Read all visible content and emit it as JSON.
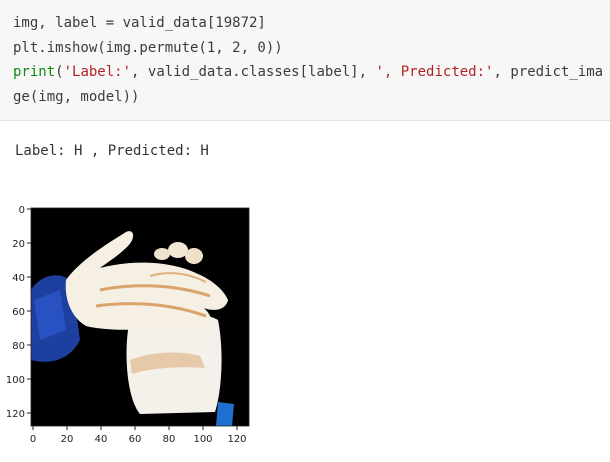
{
  "code": {
    "line1": "img, label = valid_data[19872]",
    "line2": "plt.imshow(img.permute(1, 2, 0))",
    "line3_print": "print",
    "line3_open": "(",
    "line3_str1": "'Label:'",
    "line3_mid": ", valid_data.classes[label], ",
    "line3_str2": "', Predicted:'",
    "line3_end": ", predict_ima",
    "line4": "ge(img, model))"
  },
  "output": {
    "text": "Label: H , Predicted: H"
  },
  "plot": {
    "y_ticks": [
      "0",
      "20",
      "40",
      "60",
      "80",
      "100",
      "120"
    ],
    "x_ticks": [
      "0",
      "20",
      "40",
      "60",
      "80",
      "100",
      "120"
    ],
    "image_description": "hand-sign-image"
  }
}
